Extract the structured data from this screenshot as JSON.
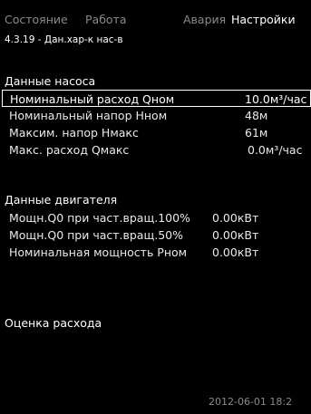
{
  "tabs": [
    "Состояние",
    "Работа",
    "Авария",
    "Настройки"
  ],
  "breadcrumb": "4.3.19 - Дан.хар-к нас-в",
  "pump_section": {
    "title": "Данные насоса",
    "rows": [
      {
        "label": "Номинальный расход Qном",
        "value": "10.0м³/час"
      },
      {
        "label": "Номинальный напор Нном",
        "value": "48м"
      },
      {
        "label": "Максим. напор Нмакс",
        "value": "61м"
      },
      {
        "label": "Макс. расход Qмакс",
        "value": "0.0м³/час"
      }
    ]
  },
  "motor_section": {
    "title": "Данные двигателя",
    "rows": [
      {
        "label": "Мощн.Q0 при част.вращ.100%",
        "value": "0.00кВт"
      },
      {
        "label": "Мощн.Q0 при част.вращ.50%",
        "value": "0.00кВт"
      },
      {
        "label": "Номинальная мощность Рном",
        "value": "0.00кВт"
      }
    ]
  },
  "flow_estimate": "Оценка расхода",
  "status_datetime": "2012-06-01 18:2"
}
